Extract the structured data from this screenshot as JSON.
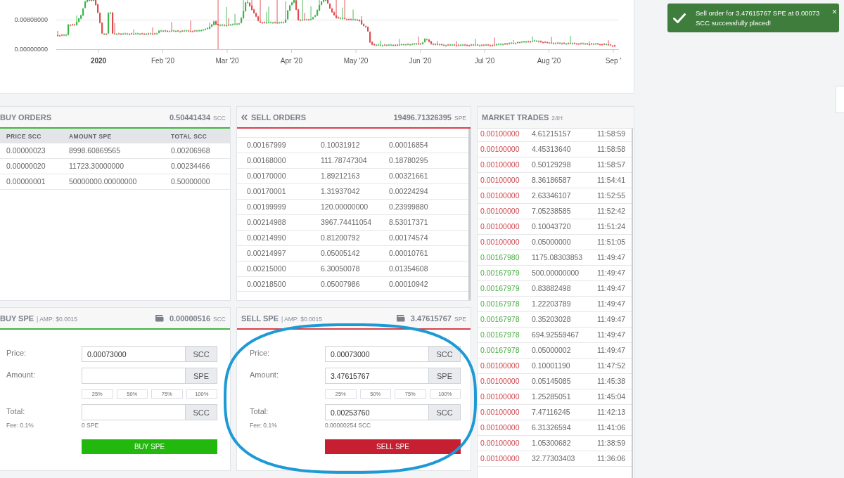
{
  "price_chart": {
    "y_axis_labels": [
      "0.00808000",
      "0.00000000"
    ],
    "x_axis_labels": [
      {
        "label": "2020",
        "kind": "year"
      },
      {
        "label": "Feb '20",
        "kind": "month"
      },
      {
        "label": "Mar '20",
        "kind": "month"
      },
      {
        "label": "Apr '20",
        "kind": "month"
      },
      {
        "label": "May '20",
        "kind": "month"
      },
      {
        "label": "Jun '20",
        "kind": "month"
      },
      {
        "label": "Jul '20",
        "kind": "month"
      },
      {
        "label": "Aug '20",
        "kind": "month"
      },
      {
        "label": "Sep '",
        "kind": "month"
      }
    ]
  },
  "buy_orders": {
    "title": "BUY ORDERS",
    "total": "0.50441434",
    "total_unit": "SCC",
    "columns": [
      "PRICE SCC",
      "AMOUNT SPE",
      "TOTAL SCC"
    ],
    "rows": [
      [
        "0.00000023",
        "8998.60869565",
        "0.00206968"
      ],
      [
        "0.00000020",
        "11723.30000000",
        "0.00234466"
      ],
      [
        "0.00000001",
        "50000000.00000000",
        "0.50000000"
      ]
    ]
  },
  "sell_orders": {
    "title": "SELL ORDERS",
    "total": "19496.71326395",
    "total_unit": "SPE",
    "rows": [
      [
        "0.00167999",
        "0.10031912",
        "0.00016854"
      ],
      [
        "0.00168000",
        "111.78747304",
        "0.18780295"
      ],
      [
        "0.00170000",
        "1.89212163",
        "0.00321661"
      ],
      [
        "0.00170001",
        "1.31937042",
        "0.00224294"
      ],
      [
        "0.00199999",
        "120.00000000",
        "0.23999880"
      ],
      [
        "0.00214988",
        "3967.74411054",
        "8.53017371"
      ],
      [
        "0.00214990",
        "0.81200792",
        "0.00174574"
      ],
      [
        "0.00214997",
        "0.05005142",
        "0.00010761"
      ],
      [
        "0.00215000",
        "6.30050078",
        "0.01354608"
      ],
      [
        "0.00218500",
        "0.05007986",
        "0.00010942"
      ]
    ]
  },
  "market_trades": {
    "title": "MARKET TRADES",
    "period": "24H",
    "rows": [
      {
        "kind": "sell",
        "price": "0.00100000",
        "amount": "4.61215157",
        "time": "11:58:59"
      },
      {
        "kind": "sell",
        "price": "0.00100000",
        "amount": "4.45313640",
        "time": "11:58:58"
      },
      {
        "kind": "sell",
        "price": "0.00100000",
        "amount": "0.50129298",
        "time": "11:58:57"
      },
      {
        "kind": "sell",
        "price": "0.00100000",
        "amount": "8.36186587",
        "time": "11:54:41"
      },
      {
        "kind": "sell",
        "price": "0.00100000",
        "amount": "2.63346107",
        "time": "11:52:55"
      },
      {
        "kind": "sell",
        "price": "0.00100000",
        "amount": "7.05238585",
        "time": "11:52:42"
      },
      {
        "kind": "sell",
        "price": "0.00100000",
        "amount": "0.10043720",
        "time": "11:51:24"
      },
      {
        "kind": "sell",
        "price": "0.00100000",
        "amount": "0.05000000",
        "time": "11:51:05"
      },
      {
        "kind": "buy",
        "price": "0.00167980",
        "amount": "1175.08303853",
        "time": "11:49:47"
      },
      {
        "kind": "buy",
        "price": "0.00167979",
        "amount": "500.00000000",
        "time": "11:49:47"
      },
      {
        "kind": "buy",
        "price": "0.00167979",
        "amount": "0.83882498",
        "time": "11:49:47"
      },
      {
        "kind": "buy",
        "price": "0.00167978",
        "amount": "1.22203789",
        "time": "11:49:47"
      },
      {
        "kind": "buy",
        "price": "0.00167978",
        "amount": "0.35203028",
        "time": "11:49:47"
      },
      {
        "kind": "buy",
        "price": "0.00167978",
        "amount": "694.92559467",
        "time": "11:49:47"
      },
      {
        "kind": "buy",
        "price": "0.00167978",
        "amount": "0.05000002",
        "time": "11:49:47"
      },
      {
        "kind": "sell",
        "price": "0.00100000",
        "amount": "0.10001190",
        "time": "11:47:52"
      },
      {
        "kind": "sell",
        "price": "0.00100000",
        "amount": "0.05145085",
        "time": "11:45:38"
      },
      {
        "kind": "sell",
        "price": "0.00100000",
        "amount": "1.25285051",
        "time": "11:45:04"
      },
      {
        "kind": "sell",
        "price": "0.00100000",
        "amount": "7.47116245",
        "time": "11:42:13"
      },
      {
        "kind": "sell",
        "price": "0.00100000",
        "amount": "6.31326594",
        "time": "11:41:06"
      },
      {
        "kind": "sell",
        "price": "0.00100000",
        "amount": "1.05300682",
        "time": "11:38:59"
      },
      {
        "kind": "sell",
        "price": "0.00100000",
        "amount": "32.77303403",
        "time": "11:36:06"
      }
    ]
  },
  "order_forms": [
    {
      "kind": "buy",
      "title": "BUY SPE",
      "note": "| AMP: $0.0015",
      "balance": "0.00000516",
      "balance_unit": "SCC",
      "price": {
        "label": "Price:",
        "value": "0.00073000",
        "unit": "SCC"
      },
      "amount": {
        "label": "Amount:",
        "unit": "SPE"
      },
      "percent_buttons": [
        "25%",
        "50%",
        "75%",
        "100%"
      ],
      "total": {
        "label": "Total:",
        "unit": "SCC"
      },
      "fee": "Fee: 0.1%",
      "fee_amount": "0 SPE",
      "submit": "BUY SPE"
    },
    {
      "kind": "sell",
      "title": "SELL SPE",
      "note": "| AMP: $0.0015",
      "balance": "3.47615767",
      "balance_unit": "SPE",
      "price": {
        "label": "Price:",
        "value": "0.00073000",
        "unit": "SCC"
      },
      "amount": {
        "label": "Amount:",
        "value": "3.47615767",
        "unit": "SPE"
      },
      "percent_buttons": [
        "25%",
        "50%",
        "75%",
        "100%"
      ],
      "total": {
        "label": "Total:",
        "value": "0.00253760",
        "unit": "SCC"
      },
      "fee": "Fee: 0.1%",
      "fee_amount": "0.00000254 SCC",
      "submit": "SELL SPE"
    }
  ],
  "toast": {
    "kind": "success",
    "message": "Sell order for 3.47615767 SPE at 0.00073 SCC successfully placed!",
    "close": "×"
  },
  "annotation": {
    "kind": "ellipse"
  }
}
